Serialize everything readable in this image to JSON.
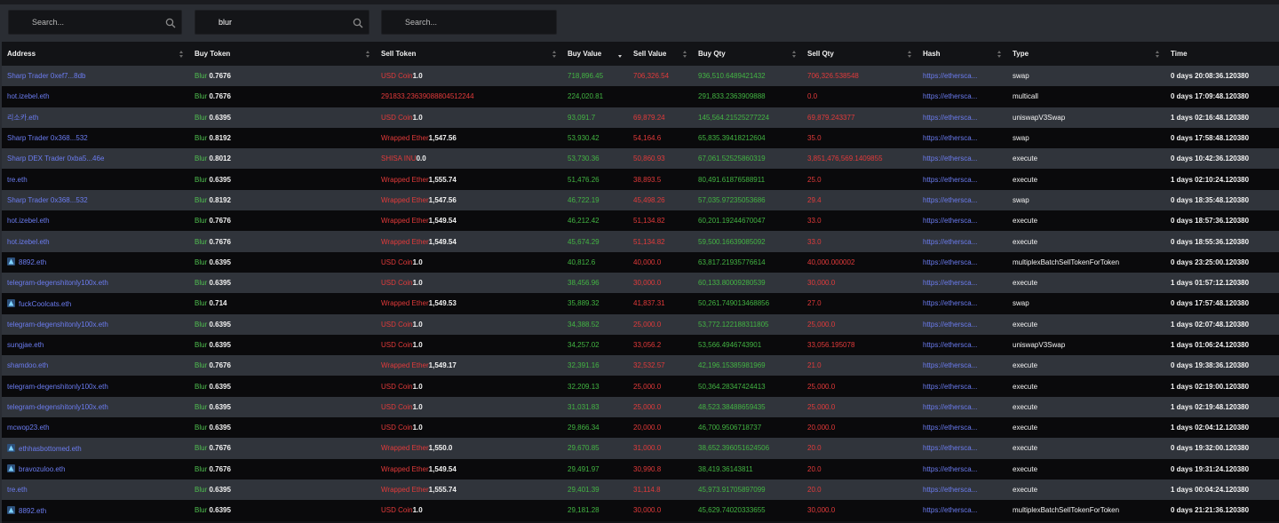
{
  "filters": {
    "search1": {
      "value": "",
      "placeholder": "Search..."
    },
    "search2": {
      "value": "blur",
      "placeholder": "Search..."
    },
    "search3": {
      "value": "",
      "placeholder": "Search..."
    }
  },
  "columns": [
    "Address",
    "Buy Token",
    "Sell Token",
    "Buy Value",
    "Sell Value",
    "Buy Qty",
    "Sell Qty",
    "Hash",
    "Type",
    "Time"
  ],
  "rows": [
    {
      "address": "Sharp Trader 0xef7...8db",
      "avatar": false,
      "buy_token": "Blur",
      "buy_price": "0.7676",
      "sell_token": "USD Coin",
      "sell_price": "1.0",
      "buy_value": "718,896.45",
      "sell_value": "706,326.54",
      "buy_qty": "936,510.6489421432",
      "sell_qty": "706,326.538548",
      "hash": "https://ethersca...",
      "type": "swap",
      "time": "0 days 20:08:36.120380"
    },
    {
      "address": "hot.izebel.eth",
      "avatar": false,
      "buy_token": "Blur",
      "buy_price": "0.7676",
      "sell_token": "291833.23639088804512244",
      "sell_price": "",
      "buy_value": "224,020.81",
      "sell_value": "",
      "buy_qty": "291,833.2363909888",
      "sell_qty": "0.0",
      "hash": "https://ethersca...",
      "type": "multicall",
      "time": "0 days 17:09:48.120380"
    },
    {
      "address": "리소카.eth",
      "avatar": false,
      "buy_token": "Blur",
      "buy_price": "0.6395",
      "sell_token": "USD Coin",
      "sell_price": "1.0",
      "buy_value": "93,091.7",
      "sell_value": "69,879.24",
      "buy_qty": "145,564.21525277224",
      "sell_qty": "69,879.243377",
      "hash": "https://ethersca...",
      "type": "uniswapV3Swap",
      "time": "1 days 02:16:48.120380"
    },
    {
      "address": "Sharp Trader 0x368...532",
      "avatar": false,
      "buy_token": "Blur",
      "buy_price": "0.8192",
      "sell_token": "Wrapped Ether",
      "sell_price": "1,547.56",
      "buy_value": "53,930.42",
      "sell_value": "54,164.6",
      "buy_qty": "65,835.39418212604",
      "sell_qty": "35.0",
      "hash": "https://ethersca...",
      "type": "swap",
      "time": "0 days 17:58:48.120380"
    },
    {
      "address": "Sharp DEX Trader 0xba5...46e",
      "avatar": false,
      "buy_token": "Blur",
      "buy_price": "0.8012",
      "sell_token": "SHISA INU",
      "sell_price": "0.0",
      "buy_value": "53,730.36",
      "sell_value": "50,860.93",
      "buy_qty": "67,061.52525860319",
      "sell_qty": "3,851,476,569.1409855",
      "hash": "https://ethersca...",
      "type": "execute",
      "time": "0 days 10:42:36.120380"
    },
    {
      "address": "tre.eth",
      "avatar": false,
      "buy_token": "Blur",
      "buy_price": "0.6395",
      "sell_token": "Wrapped Ether",
      "sell_price": "1,555.74",
      "buy_value": "51,476.26",
      "sell_value": "38,893.5",
      "buy_qty": "80,491.61876588911",
      "sell_qty": "25.0",
      "hash": "https://ethersca...",
      "type": "execute",
      "time": "1 days 02:10:24.120380"
    },
    {
      "address": "Sharp Trader 0x368...532",
      "avatar": false,
      "buy_token": "Blur",
      "buy_price": "0.8192",
      "sell_token": "Wrapped Ether",
      "sell_price": "1,547.56",
      "buy_value": "46,722.19",
      "sell_value": "45,498.26",
      "buy_qty": "57,035.97235053686",
      "sell_qty": "29.4",
      "hash": "https://ethersca...",
      "type": "swap",
      "time": "0 days 18:35:48.120380"
    },
    {
      "address": "hot.izebel.eth",
      "avatar": false,
      "buy_token": "Blur",
      "buy_price": "0.7676",
      "sell_token": "Wrapped Ether",
      "sell_price": "1,549.54",
      "buy_value": "46,212.42",
      "sell_value": "51,134.82",
      "buy_qty": "60,201.19244670047",
      "sell_qty": "33.0",
      "hash": "https://ethersca...",
      "type": "execute",
      "time": "0 days 18:57:36.120380"
    },
    {
      "address": "hot.izebel.eth",
      "avatar": false,
      "buy_token": "Blur",
      "buy_price": "0.7676",
      "sell_token": "Wrapped Ether",
      "sell_price": "1,549.54",
      "buy_value": "45,674.29",
      "sell_value": "51,134.82",
      "buy_qty": "59,500.16639085092",
      "sell_qty": "33.0",
      "hash": "https://ethersca...",
      "type": "execute",
      "time": "0 days 18:55:36.120380"
    },
    {
      "address": "8892.eth",
      "avatar": true,
      "buy_token": "Blur",
      "buy_price": "0.6395",
      "sell_token": "USD Coin",
      "sell_price": "1.0",
      "buy_value": "40,812.6",
      "sell_value": "40,000.0",
      "buy_qty": "63,817.21935776614",
      "sell_qty": "40,000.000002",
      "hash": "https://ethersca...",
      "type": "multiplexBatchSellTokenForToken",
      "time": "0 days 23:25:00.120380"
    },
    {
      "address": "telegram-degenshitonly100x.eth",
      "avatar": false,
      "buy_token": "Blur",
      "buy_price": "0.6395",
      "sell_token": "USD Coin",
      "sell_price": "1.0",
      "buy_value": "38,456.96",
      "sell_value": "30,000.0",
      "buy_qty": "60,133.80009280539",
      "sell_qty": "30,000.0",
      "hash": "https://ethersca...",
      "type": "execute",
      "time": "1 days 01:57:12.120380"
    },
    {
      "address": "fuckCoolcats.eth",
      "avatar": true,
      "buy_token": "Blur",
      "buy_price": "0.714",
      "sell_token": "Wrapped Ether",
      "sell_price": "1,549.53",
      "buy_value": "35,889.32",
      "sell_value": "41,837.31",
      "buy_qty": "50,261.749013468856",
      "sell_qty": "27.0",
      "hash": "https://ethersca...",
      "type": "swap",
      "time": "0 days 17:57:48.120380"
    },
    {
      "address": "telegram-degenshitonly100x.eth",
      "avatar": false,
      "buy_token": "Blur",
      "buy_price": "0.6395",
      "sell_token": "USD Coin",
      "sell_price": "1.0",
      "buy_value": "34,388.52",
      "sell_value": "25,000.0",
      "buy_qty": "53,772.122188311805",
      "sell_qty": "25,000.0",
      "hash": "https://ethersca...",
      "type": "execute",
      "time": "1 days 02:07:48.120380"
    },
    {
      "address": "sungjae.eth",
      "avatar": false,
      "buy_token": "Blur",
      "buy_price": "0.6395",
      "sell_token": "USD Coin",
      "sell_price": "1.0",
      "buy_value": "34,257.02",
      "sell_value": "33,056.2",
      "buy_qty": "53,566.4946743901",
      "sell_qty": "33,056.195078",
      "hash": "https://ethersca...",
      "type": "uniswapV3Swap",
      "time": "1 days 01:06:24.120380"
    },
    {
      "address": "shamdoo.eth",
      "avatar": false,
      "buy_token": "Blur",
      "buy_price": "0.7676",
      "sell_token": "Wrapped Ether",
      "sell_price": "1,549.17",
      "buy_value": "32,391.16",
      "sell_value": "32,532.57",
      "buy_qty": "42,196.15385981969",
      "sell_qty": "21.0",
      "hash": "https://ethersca...",
      "type": "execute",
      "time": "0 days 19:38:36.120380"
    },
    {
      "address": "telegram-degenshitonly100x.eth",
      "avatar": false,
      "buy_token": "Blur",
      "buy_price": "0.6395",
      "sell_token": "USD Coin",
      "sell_price": "1.0",
      "buy_value": "32,209.13",
      "sell_value": "25,000.0",
      "buy_qty": "50,364.28347424413",
      "sell_qty": "25,000.0",
      "hash": "https://ethersca...",
      "type": "execute",
      "time": "1 days 02:19:00.120380"
    },
    {
      "address": "telegram-degenshitonly100x.eth",
      "avatar": false,
      "buy_token": "Blur",
      "buy_price": "0.6395",
      "sell_token": "USD Coin",
      "sell_price": "1.0",
      "buy_value": "31,031.83",
      "sell_value": "25,000.0",
      "buy_qty": "48,523.38488659435",
      "sell_qty": "25,000.0",
      "hash": "https://ethersca...",
      "type": "execute",
      "time": "1 days 02:19:48.120380"
    },
    {
      "address": "mcwop23.eth",
      "avatar": false,
      "buy_token": "Blur",
      "buy_price": "0.6395",
      "sell_token": "USD Coin",
      "sell_price": "1.0",
      "buy_value": "29,866.34",
      "sell_value": "20,000.0",
      "buy_qty": "46,700.9506718737",
      "sell_qty": "20,000.0",
      "hash": "https://ethersca...",
      "type": "execute",
      "time": "1 days 02:04:12.120380"
    },
    {
      "address": "ethhasbottomed.eth",
      "avatar": true,
      "buy_token": "Blur",
      "buy_price": "0.7676",
      "sell_token": "Wrapped Ether",
      "sell_price": "1,550.0",
      "buy_value": "29,670.85",
      "sell_value": "31,000.0",
      "buy_qty": "38,652.396051624506",
      "sell_qty": "20.0",
      "hash": "https://ethersca...",
      "type": "execute",
      "time": "0 days 19:32:00.120380"
    },
    {
      "address": "bravozuloo.eth",
      "avatar": true,
      "buy_token": "Blur",
      "buy_price": "0.7676",
      "sell_token": "Wrapped Ether",
      "sell_price": "1,549.54",
      "buy_value": "29,491.97",
      "sell_value": "30,990.8",
      "buy_qty": "38,419.36143811",
      "sell_qty": "20.0",
      "hash": "https://ethersca...",
      "type": "execute",
      "time": "0 days 19:31:24.120380"
    },
    {
      "address": "tre.eth",
      "avatar": false,
      "buy_token": "Blur",
      "buy_price": "0.6395",
      "sell_token": "Wrapped Ether",
      "sell_price": "1,555.74",
      "buy_value": "29,401.39",
      "sell_value": "31,114.8",
      "buy_qty": "45,973.91705897099",
      "sell_qty": "20.0",
      "hash": "https://ethersca...",
      "type": "execute",
      "time": "1 days 00:04:24.120380"
    },
    {
      "address": "8892.eth",
      "avatar": true,
      "buy_token": "Blur",
      "buy_price": "0.6395",
      "sell_token": "USD Coin",
      "sell_price": "1.0",
      "buy_value": "29,181.28",
      "sell_value": "30,000.0",
      "buy_qty": "45,629.74020333655",
      "sell_qty": "30,000.0",
      "hash": "https://ethersca...",
      "type": "multiplexBatchSellTokenForToken",
      "time": "0 days 21:21:36.120380"
    }
  ],
  "colors": {
    "address": "#6b7cf0",
    "token": "#4fbf4f",
    "positive": "#43b543",
    "negative": "#e23a3a",
    "row_odd": "#30343b",
    "row_even": "#0a0a0c"
  },
  "icons": {
    "search": "magnifier-icon",
    "sort": "sort-icon",
    "avatar": "avatar-icon"
  }
}
